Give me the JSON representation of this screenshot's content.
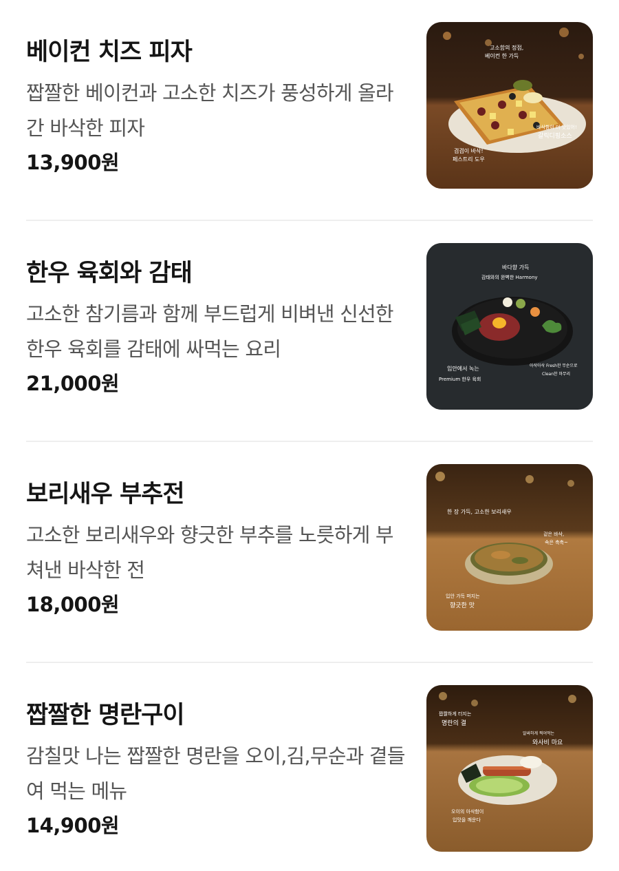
{
  "menu": {
    "items": [
      {
        "name": "베이컨 치즈 피자",
        "description": "짭짤한 베이컨과 고소한 치즈가 풍성하게 올라간 바삭한 피자",
        "price": "13,900원",
        "image_icon": "pizza-photo-icon"
      },
      {
        "name": "한우 육회와 감태",
        "description": "고소한 참기름과 함께 부드럽게 비벼낸 신선한 한우 육회를 감태에 싸먹는 요리",
        "price": "21,000원",
        "image_icon": "beef-tartare-photo-icon"
      },
      {
        "name": "보리새우 부추전",
        "description": "고소한 보리새우와 향긋한 부추를 노릇하게 부쳐낸 바삭한 전",
        "price": "18,000원",
        "image_icon": "pancake-photo-icon"
      },
      {
        "name": "짭짤한 명란구이",
        "description": "감칠맛 나는 짭짤한 명란을 오이,김,무순과 곁들여 먹는 메뉴",
        "price": "14,900원",
        "image_icon": "grilled-roe-photo-icon"
      }
    ]
  },
  "photo_captions": {
    "pizza": [
      "고소함의 정점,",
      "베이컨 한 가득",
      "바삭함이 더 맛있어!",
      "갈릭디핑소스",
      "겹겹이 바삭!",
      "페스트리 도우"
    ],
    "tartare": [
      "바다향 가득",
      "감태와의 완벽한 Harmony",
      "입안에서 녹는",
      "Premium 한우 육회",
      "아삭아삭 Fresh한 무순으로",
      "Clean한 마무리"
    ],
    "pancake": [
      "한 장 가득, 고소한 보리새우",
      "겉은 바삭,",
      "속은 촉촉~",
      "입안 가득 퍼지는",
      "향긋한 맛"
    ],
    "roe": [
      "짭짤하게 터지는",
      "명란의 결",
      "알싸하게 찍어먹는",
      "와사비 마요",
      "오이의 아삭함이",
      "입맛을 깨운다"
    ]
  },
  "colors": {
    "title": "#151515",
    "description": "#555555",
    "divider": "#eeeeee",
    "background": "#ffffff"
  }
}
